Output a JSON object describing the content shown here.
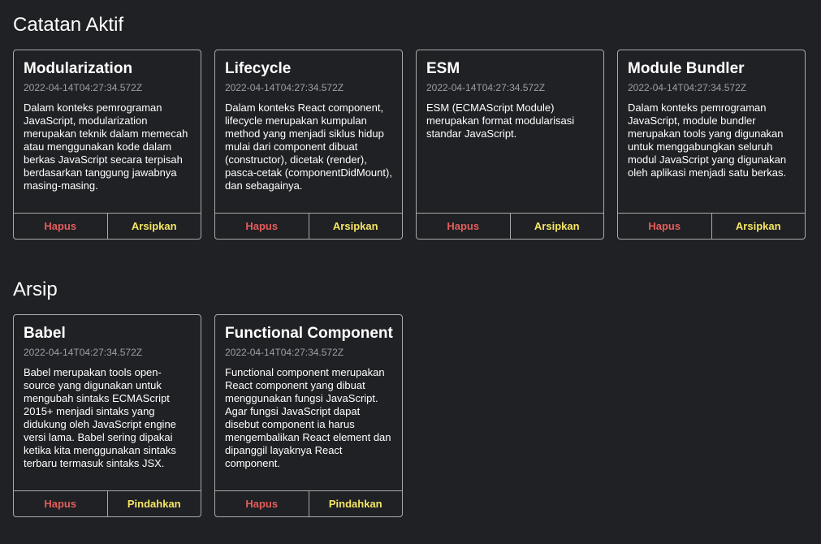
{
  "colors": {
    "background": "#202124",
    "delete": "#e35d5b",
    "archive": "#f5e663",
    "border": "#aaaaaa",
    "date": "#9aa0a6"
  },
  "active": {
    "heading": "Catatan Aktif",
    "notes": [
      {
        "title": "Modularization",
        "date": "2022-04-14T04:27:34.572Z",
        "body": "Dalam konteks pemrograman JavaScript, modularization merupakan teknik dalam memecah atau menggunakan kode dalam berkas JavaScript secara terpisah berdasarkan tanggung jawabnya masing-masing.",
        "delete_label": "Hapus",
        "archive_label": "Arsipkan"
      },
      {
        "title": "Lifecycle",
        "date": "2022-04-14T04:27:34.572Z",
        "body": "Dalam konteks React component, lifecycle merupakan kumpulan method yang menjadi siklus hidup mulai dari component dibuat (constructor), dicetak (render), pasca-cetak (componentDidMount), dan sebagainya.",
        "delete_label": "Hapus",
        "archive_label": "Arsipkan"
      },
      {
        "title": "ESM",
        "date": "2022-04-14T04:27:34.572Z",
        "body": "ESM (ECMAScript Module) merupakan format modularisasi standar JavaScript.",
        "delete_label": "Hapus",
        "archive_label": "Arsipkan"
      },
      {
        "title": "Module Bundler",
        "date": "2022-04-14T04:27:34.572Z",
        "body": "Dalam konteks pemrograman JavaScript, module bundler merupakan tools yang digunakan untuk menggabungkan seluruh modul JavaScript yang digunakan oleh aplikasi menjadi satu berkas.",
        "delete_label": "Hapus",
        "archive_label": "Arsipkan"
      }
    ]
  },
  "archive": {
    "heading": "Arsip",
    "notes": [
      {
        "title": "Babel",
        "date": "2022-04-14T04:27:34.572Z",
        "body": "Babel merupakan tools open-source yang digunakan untuk mengubah sintaks ECMAScript 2015+ menjadi sintaks yang didukung oleh JavaScript engine versi lama. Babel sering dipakai ketika kita menggunakan sintaks terbaru termasuk sintaks JSX.",
        "delete_label": "Hapus",
        "move_label": "Pindahkan"
      },
      {
        "title": "Functional Component",
        "date": "2022-04-14T04:27:34.572Z",
        "body": "Functional component merupakan React component yang dibuat menggunakan fungsi JavaScript. Agar fungsi JavaScript dapat disebut component ia harus mengembalikan React element dan dipanggil layaknya React component.",
        "delete_label": "Hapus",
        "move_label": "Pindahkan"
      }
    ]
  }
}
